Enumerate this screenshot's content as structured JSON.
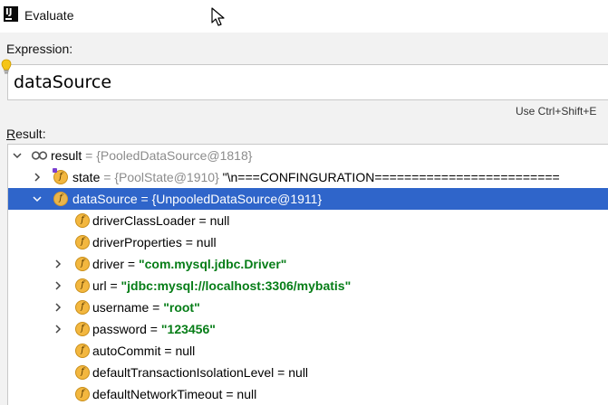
{
  "window": {
    "title": "Evaluate"
  },
  "expression": {
    "label": "Expression:",
    "value": "dataSource"
  },
  "hint": "Use Ctrl+Shift+E",
  "result": {
    "label_underlined": "R",
    "label_rest": "esult:",
    "root": {
      "name": "result",
      "eq": " = ",
      "value": "{PooledDataSource@1818}"
    },
    "state": {
      "name": "state",
      "eq": " = ",
      "value": "{PoolState@1910} ",
      "str": "\"\\n===CONFINGURATION========================="
    },
    "datasource": {
      "name": "dataSource",
      "eq": " = ",
      "value": "{UnpooledDataSource@1911}"
    },
    "children": [
      {
        "name": "driverClassLoader",
        "eq": " = ",
        "value": "null",
        "kind": "null",
        "expandable": false
      },
      {
        "name": "driverProperties",
        "eq": " = ",
        "value": "null",
        "kind": "null",
        "expandable": false
      },
      {
        "name": "driver",
        "eq": " = ",
        "value": "\"com.mysql.jdbc.Driver\"",
        "kind": "str",
        "expandable": true
      },
      {
        "name": "url",
        "eq": " = ",
        "value": "\"jdbc:mysql://localhost:3306/mybatis\"",
        "kind": "str",
        "expandable": true
      },
      {
        "name": "username",
        "eq": " = ",
        "value": "\"root\"",
        "kind": "str",
        "expandable": true
      },
      {
        "name": "password",
        "eq": " = ",
        "value": "\"123456\"",
        "kind": "str",
        "expandable": true
      },
      {
        "name": "autoCommit",
        "eq": " = ",
        "value": "null",
        "kind": "null",
        "expandable": false
      },
      {
        "name": "defaultTransactionIsolationLevel",
        "eq": " = ",
        "value": "null",
        "kind": "null",
        "expandable": false
      },
      {
        "name": "defaultNetworkTimeout",
        "eq": " = ",
        "value": "null",
        "kind": "null",
        "expandable": false
      }
    ]
  },
  "badge_letter": "f",
  "colors": {
    "selection": "#2f65ca",
    "string": "#067d17",
    "badge": "#f3b73f",
    "secondary": "#8c8c8c"
  }
}
